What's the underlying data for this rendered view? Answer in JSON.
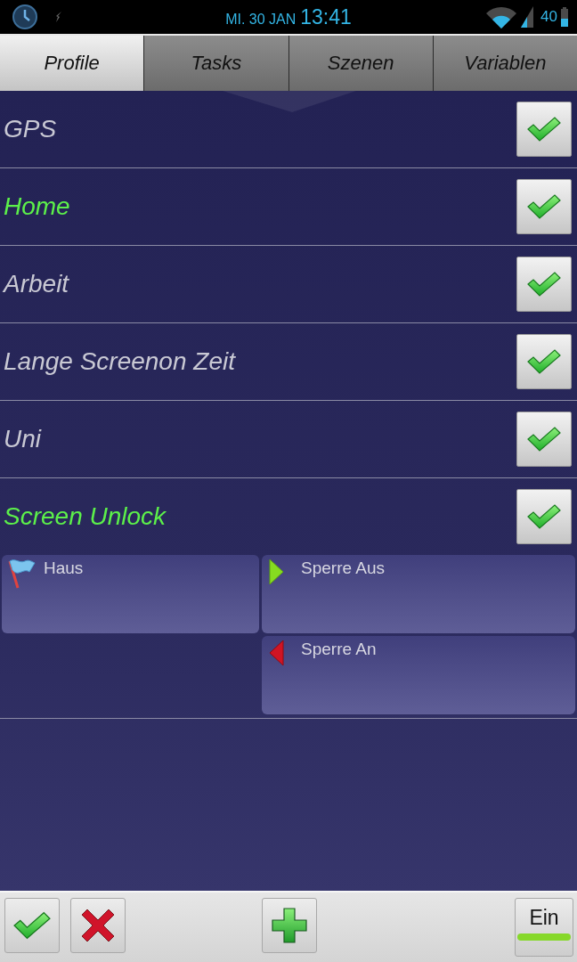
{
  "status_bar": {
    "date": "MI. 30 JAN",
    "time": "13:41",
    "battery": "40"
  },
  "tabs": [
    {
      "label": "Profile",
      "selected": true
    },
    {
      "label": "Tasks",
      "selected": false
    },
    {
      "label": "Szenen",
      "selected": false
    },
    {
      "label": "Variablen",
      "selected": false
    }
  ],
  "profiles": [
    {
      "name": "GPS",
      "active": false,
      "checked": true,
      "expanded": false
    },
    {
      "name": "Home",
      "active": true,
      "checked": true,
      "expanded": false
    },
    {
      "name": "Arbeit",
      "active": false,
      "checked": true,
      "expanded": false
    },
    {
      "name": "Lange Screenon Zeit",
      "active": false,
      "checked": true,
      "expanded": false
    },
    {
      "name": "Uni",
      "active": false,
      "checked": true,
      "expanded": false
    },
    {
      "name": "Screen Unlock",
      "active": true,
      "checked": true,
      "expanded": true,
      "contexts": [
        {
          "label": "Haus",
          "kind": "location"
        }
      ],
      "tasks": [
        {
          "label": "Sperre Aus",
          "kind": "enter"
        },
        {
          "label": "Sperre An",
          "kind": "exit"
        }
      ]
    }
  ],
  "toolbar": {
    "toggle": {
      "label": "Ein",
      "on": true
    }
  }
}
